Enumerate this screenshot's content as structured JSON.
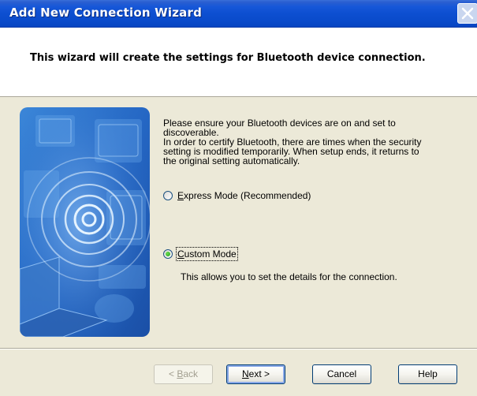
{
  "window": {
    "title": "Add New Connection Wizard",
    "close_label": "Close"
  },
  "header": {
    "text": "This wizard will create the settings for Bluetooth device connection."
  },
  "content": {
    "line1": "Please ensure your Bluetooth devices are on and set to",
    "line2": "discoverable.",
    "line3": "In order to certify Bluetooth, there are times when the security",
    "line4": "setting is modified temporarily. When setup ends, it returns to",
    "line5": "the original setting automatically."
  },
  "options": {
    "express": {
      "accel": "E",
      "rest": "xpress Mode (Recommended)",
      "selected": false
    },
    "custom": {
      "accel": "C",
      "rest": "ustom Mode",
      "selected": true
    },
    "custom_desc": "This allows you to set the details for the connection."
  },
  "buttons": {
    "back": {
      "prefix": "< ",
      "accel": "B",
      "rest": "ack",
      "enabled": false
    },
    "next": {
      "accel": "N",
      "rest": "ext >",
      "enabled": true
    },
    "cancel": "Cancel",
    "help": "Help"
  },
  "colors": {
    "title_bar": "#0a4bcb",
    "dialog_bg": "#ece9d8",
    "image_bg": "#2a6fc9"
  }
}
